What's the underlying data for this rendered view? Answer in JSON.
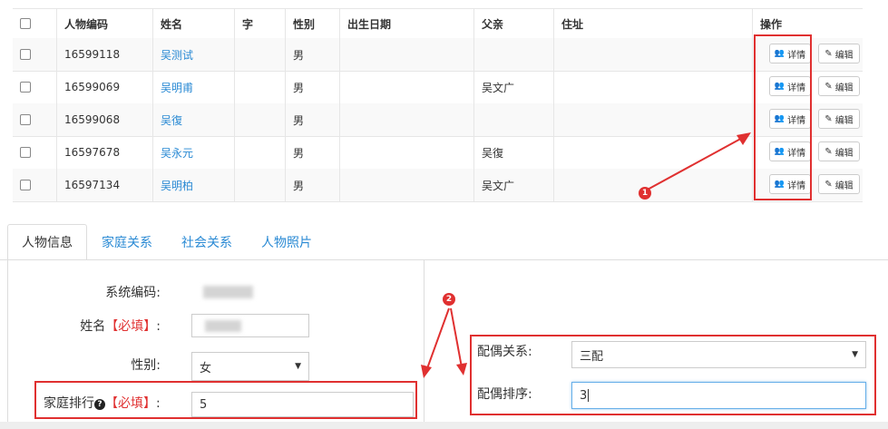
{
  "table": {
    "headers": [
      "",
      "人物编码",
      "姓名",
      "字",
      "性别",
      "出生日期",
      "父亲",
      "住址",
      "操作"
    ],
    "rows": [
      {
        "id": "16599118",
        "name": "吴测试",
        "zi": "",
        "gender": "男",
        "birth": "",
        "father": "",
        "address": ""
      },
      {
        "id": "16599069",
        "name": "吴明甫",
        "zi": "",
        "gender": "男",
        "birth": "",
        "father": "吴文广",
        "address": ""
      },
      {
        "id": "16599068",
        "name": "吴復",
        "zi": "",
        "gender": "男",
        "birth": "",
        "father": "",
        "address": ""
      },
      {
        "id": "16597678",
        "name": "吴永元",
        "zi": "",
        "gender": "男",
        "birth": "",
        "father": "吴復",
        "address": ""
      },
      {
        "id": "16597134",
        "name": "吴明柏",
        "zi": "",
        "gender": "男",
        "birth": "",
        "father": "吴文广",
        "address": ""
      }
    ],
    "detail_label": "详情",
    "edit_label": "编辑"
  },
  "annotations": {
    "badge1": "1",
    "badge2": "2"
  },
  "tabs": [
    "人物信息",
    "家庭关系",
    "社会关系",
    "人物照片"
  ],
  "form": {
    "system_code_label": "系统编码:",
    "name_label": "姓名",
    "required_tag": "【必填】",
    "colon": ":",
    "gender_label": "性别:",
    "gender_value": "女",
    "family_rank_label": "家庭排行",
    "family_rank_value": "5"
  },
  "spouse": {
    "relation_label": "配偶关系:",
    "relation_value": "三配",
    "order_label": "配偶排序:",
    "order_value": "3"
  },
  "colors": {
    "link": "#2a8ad4",
    "annotation": "#e03030",
    "border": "#e6e6e6"
  }
}
